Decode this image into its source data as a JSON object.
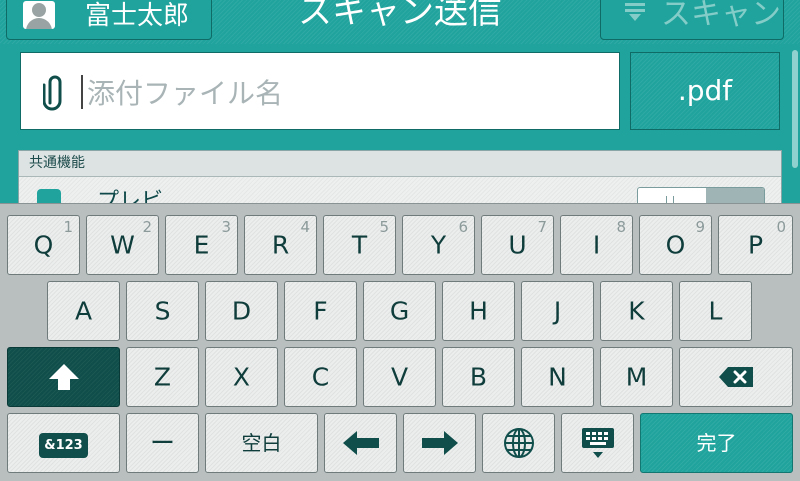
{
  "header": {
    "user_name": "富士太郎",
    "title": "スキャン送信",
    "scan_label": "スキャン"
  },
  "attachment": {
    "name_placeholder": "添付ファイル名",
    "name_value": "",
    "extension_label": ".pdf"
  },
  "settings_panel": {
    "heading": "共通機能",
    "preview_label": "プレビ",
    "preview_on": true
  },
  "keyboard": {
    "row1": [
      {
        "key": "Q",
        "num": "1"
      },
      {
        "key": "W",
        "num": "2"
      },
      {
        "key": "E",
        "num": "3"
      },
      {
        "key": "R",
        "num": "4"
      },
      {
        "key": "T",
        "num": "5"
      },
      {
        "key": "Y",
        "num": "6"
      },
      {
        "key": "U",
        "num": "7"
      },
      {
        "key": "I",
        "num": "8"
      },
      {
        "key": "O",
        "num": "9"
      },
      {
        "key": "P",
        "num": "0"
      }
    ],
    "row2": [
      "A",
      "S",
      "D",
      "F",
      "G",
      "H",
      "J",
      "K",
      "L"
    ],
    "row3": [
      "Z",
      "X",
      "C",
      "V",
      "B",
      "N",
      "M"
    ],
    "symbols_label": "&123",
    "dash_label": "ー",
    "space_label": "空白",
    "done_label": "完了"
  },
  "colors": {
    "accent": "#1fa39c",
    "dark": "#0f4e4a",
    "key_face": "#eceeee"
  }
}
